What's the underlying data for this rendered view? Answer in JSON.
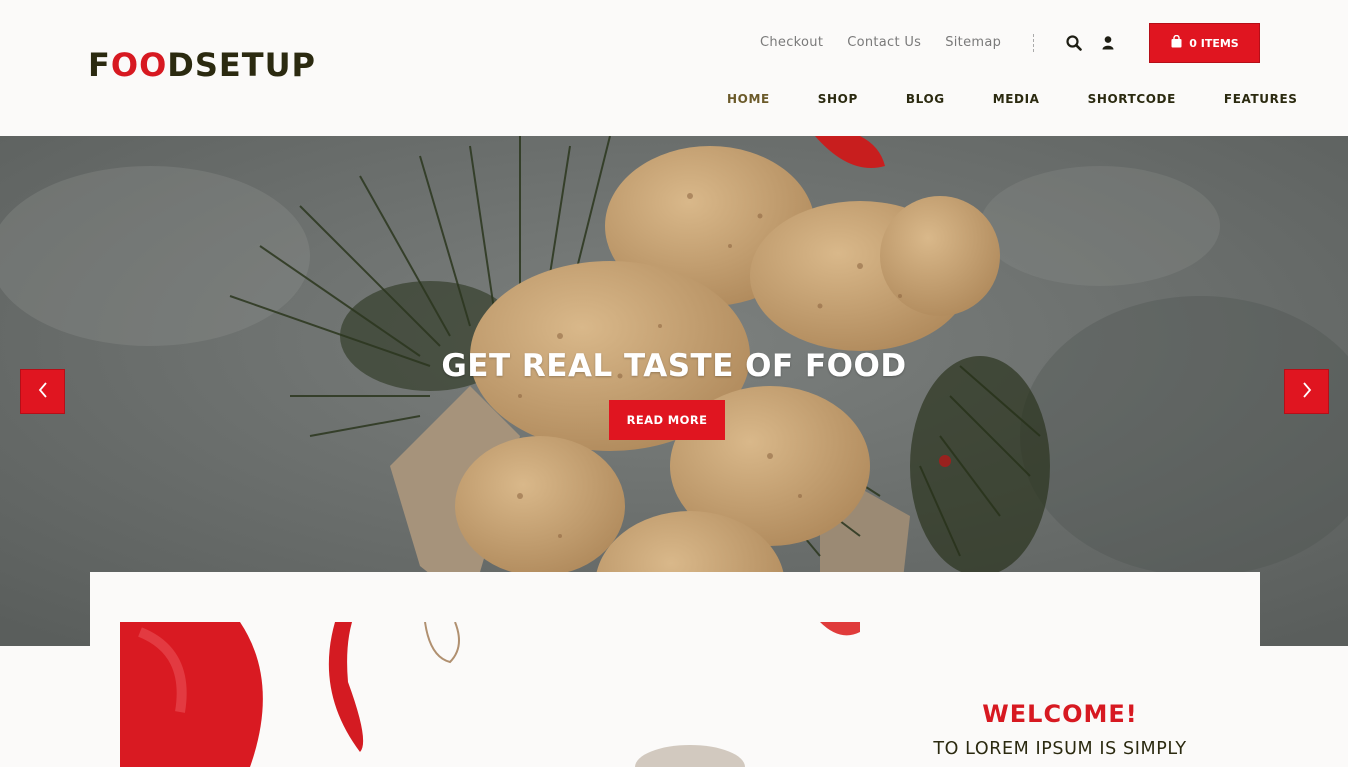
{
  "brand": {
    "logo_prefix": "F",
    "logo_accent": "OO",
    "logo_suffix": "DSETUP"
  },
  "top_links": [
    "Checkout",
    "Contact Us",
    "Sitemap"
  ],
  "cart": {
    "label": "0 ITEMS"
  },
  "nav": [
    "HOME",
    "SHOP",
    "BLOG",
    "MEDIA",
    "SHORTCODE",
    "FEATURES"
  ],
  "hero": {
    "title": "GET REAL TASTE OF FOOD",
    "button": "READ MORE"
  },
  "welcome": {
    "title": "WELCOME!",
    "subtitle": "TO LOREM IPSUM IS SIMPLY"
  },
  "colors": {
    "accent": "#e01520",
    "dark": "#2b2a10",
    "background": "#fbfaf9"
  },
  "icons": [
    "search-icon",
    "user-icon",
    "shopping-bag-icon",
    "chevron-left-icon",
    "chevron-right-icon"
  ]
}
